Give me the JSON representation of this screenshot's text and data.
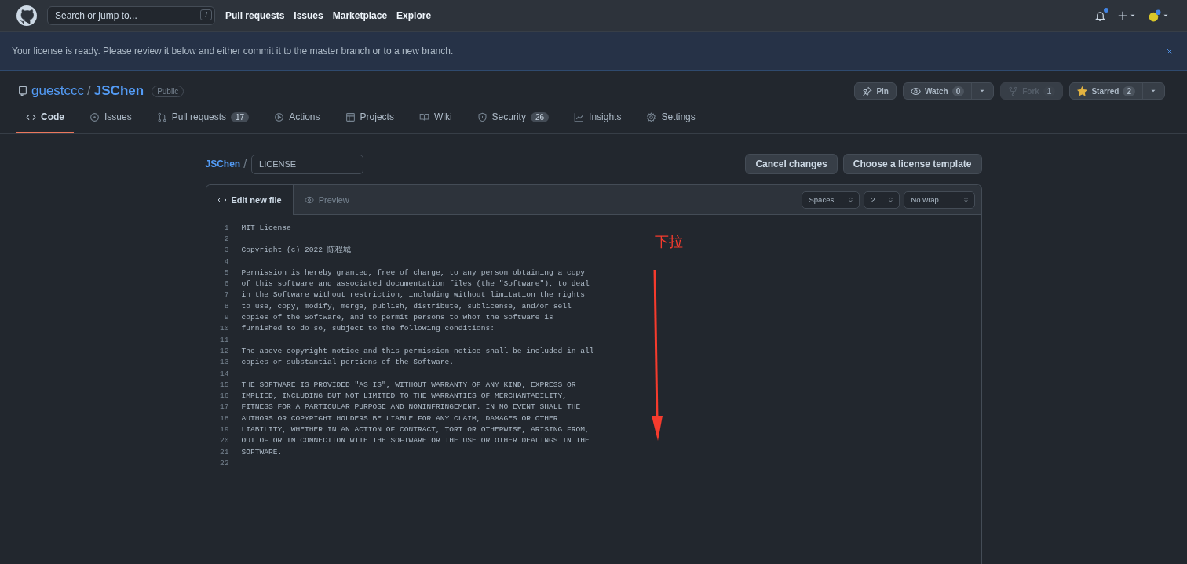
{
  "header": {
    "search_placeholder": "Search or jump to...",
    "search_key": "/",
    "nav": [
      "Pull requests",
      "Issues",
      "Marketplace",
      "Explore"
    ],
    "notifications_unread": true
  },
  "flash": {
    "message": "Your license is ready. Please review it below and either commit it to the master branch or to a new branch."
  },
  "repo": {
    "owner": "guestccc",
    "separator": "/",
    "name": "JSChen",
    "visibility": "Public"
  },
  "repo_actions": [
    {
      "kind": "pin",
      "label": "Pin",
      "disabled": false,
      "dropdown": false
    },
    {
      "kind": "watch",
      "label": "Watch",
      "count": "0",
      "disabled": false,
      "dropdown": true
    },
    {
      "kind": "fork",
      "label": "Fork",
      "count": "1",
      "disabled": true,
      "dropdown": false
    },
    {
      "kind": "star",
      "label": "Starred",
      "count": "2",
      "disabled": false,
      "dropdown": true
    }
  ],
  "tabs": [
    {
      "kind": "code",
      "label": "Code",
      "selected": true
    },
    {
      "kind": "issues",
      "label": "Issues",
      "selected": false
    },
    {
      "kind": "pulls",
      "label": "Pull requests",
      "count": "17",
      "selected": false
    },
    {
      "kind": "actions",
      "label": "Actions",
      "selected": false
    },
    {
      "kind": "projects",
      "label": "Projects",
      "selected": false
    },
    {
      "kind": "wiki",
      "label": "Wiki",
      "selected": false
    },
    {
      "kind": "security",
      "label": "Security",
      "count": "26",
      "selected": false
    },
    {
      "kind": "insights",
      "label": "Insights",
      "selected": false
    },
    {
      "kind": "settings",
      "label": "Settings",
      "selected": false
    }
  ],
  "breadcrumb": {
    "repo": "JSChen",
    "separator": "/",
    "filename": "LICENSE"
  },
  "editor_buttons": [
    "Cancel changes",
    "Choose a license template"
  ],
  "editor_tabs": [
    {
      "kind": "edit",
      "label": "Edit new file",
      "selected": true
    },
    {
      "kind": "preview",
      "label": "Preview",
      "selected": false
    }
  ],
  "editor_selects": [
    {
      "value": "Spaces"
    },
    {
      "value": "2"
    },
    {
      "value": "No wrap"
    }
  ],
  "code_lines": [
    {
      "number": "1",
      "text": "MIT License"
    },
    {
      "number": "2"
    },
    {
      "number": "3",
      "text": "Copyright (c) 2022 陈程城"
    },
    {
      "number": "4"
    },
    {
      "number": "5",
      "text": "Permission is hereby granted, free of charge, to any person obtaining a copy"
    },
    {
      "number": "6",
      "text": "of this software and associated documentation files (the \"Software\"), to deal"
    },
    {
      "number": "7",
      "text": "in the Software without restriction, including without limitation the rights"
    },
    {
      "number": "8",
      "text": "to use, copy, modify, merge, publish, distribute, sublicense, and/or sell"
    },
    {
      "number": "9",
      "text": "copies of the Software, and to permit persons to whom the Software is"
    },
    {
      "number": "10",
      "text": "furnished to do so, subject to the following conditions:"
    },
    {
      "number": "11"
    },
    {
      "number": "12",
      "text": "The above copyright notice and this permission notice shall be included in all"
    },
    {
      "number": "13",
      "text": "copies or substantial portions of the Software."
    },
    {
      "number": "14"
    },
    {
      "number": "15",
      "text": "THE SOFTWARE IS PROVIDED \"AS IS\", WITHOUT WARRANTY OF ANY KIND, EXPRESS OR"
    },
    {
      "number": "16",
      "text": "IMPLIED, INCLUDING BUT NOT LIMITED TO THE WARRANTIES OF MERCHANTABILITY,"
    },
    {
      "number": "17",
      "text": "FITNESS FOR A PARTICULAR PURPOSE AND NONINFRINGEMENT. IN NO EVENT SHALL THE"
    },
    {
      "number": "18",
      "text": "AUTHORS OR COPYRIGHT HOLDERS BE LIABLE FOR ANY CLAIM, DAMAGES OR OTHER"
    },
    {
      "number": "19",
      "text": "LIABILITY, WHETHER IN AN ACTION OF CONTRACT, TORT OR OTHERWISE, ARISING FROM,"
    },
    {
      "number": "20",
      "text": "OUT OF OR IN CONNECTION WITH THE SOFTWARE OR THE USE OR OTHER DEALINGS IN THE"
    },
    {
      "number": "21",
      "text": "SOFTWARE."
    },
    {
      "number": "22"
    }
  ],
  "annotation": {
    "text": "下拉"
  }
}
